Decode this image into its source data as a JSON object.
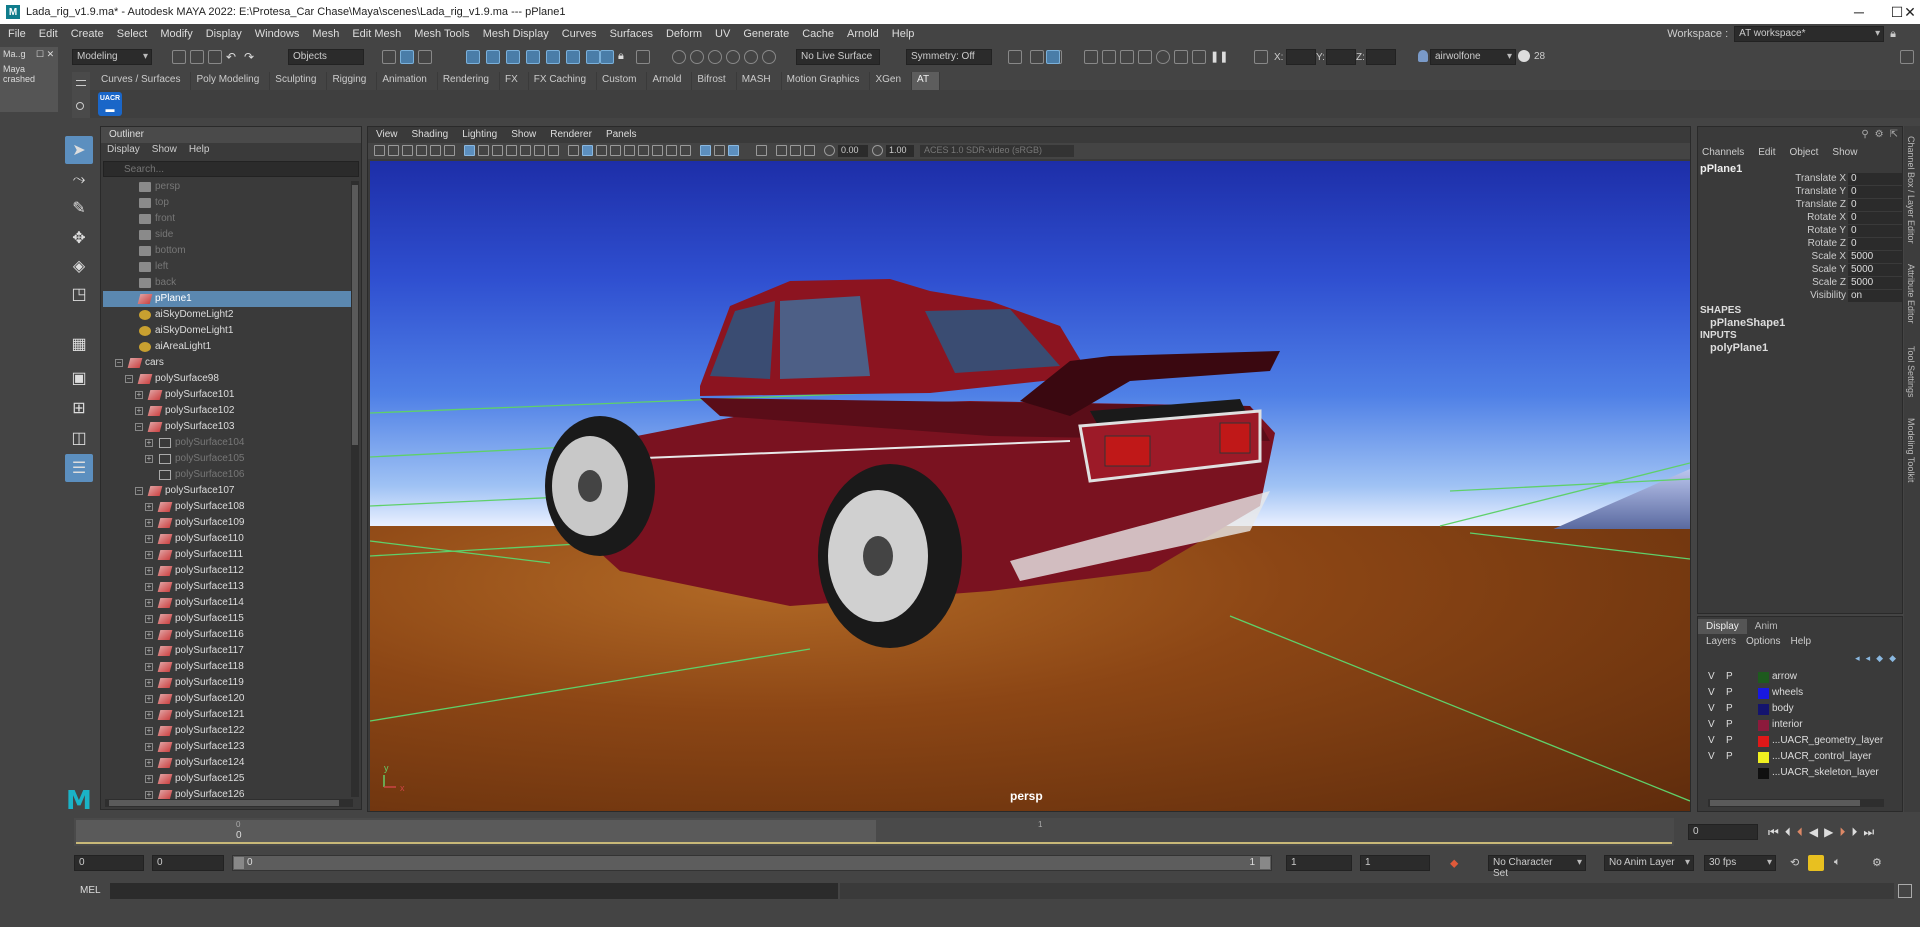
{
  "titlebar": {
    "title": "Lada_rig_v1.9.ma* - Autodesk MAYA 2022: E:\\Protesa_Car Chase\\Maya\\scenes\\Lada_rig_v1.9.ma  ---   pPlane1",
    "logo": "M"
  },
  "menubar": {
    "items": [
      "File",
      "Edit",
      "Create",
      "Select",
      "Modify",
      "Display",
      "Windows",
      "Mesh",
      "Edit Mesh",
      "Mesh Tools",
      "Mesh Display",
      "Curves",
      "Surfaces",
      "Deform",
      "UV",
      "Generate",
      "Cache",
      "Arnold",
      "Help"
    ],
    "workspace_label": "Workspace :",
    "workspace_value": "AT workspace*"
  },
  "statusline": {
    "mode": "Modeling",
    "select_mode": "Objects",
    "live_surface": "No Live Surface",
    "symmetry": "Symmetry: Off",
    "x_label": "X:",
    "y_label": "Y:",
    "z_label": "Z:",
    "user": "airwolfone",
    "notifications": "28"
  },
  "crashside": {
    "tab": "Ma..g",
    "message": "Maya crashed"
  },
  "shelf": {
    "tabs": [
      "Curves / Surfaces",
      "Poly Modeling",
      "Sculpting",
      "Rigging",
      "Animation",
      "Rendering",
      "FX",
      "FX Caching",
      "Custom",
      "Arnold",
      "Bifrost",
      "MASH",
      "Motion Graphics",
      "XGen",
      "AT"
    ],
    "active_tab": "AT",
    "uacr_label": "UACR"
  },
  "outliner": {
    "title": "Outliner",
    "menu": [
      "Display",
      "Show",
      "Help"
    ],
    "search_placeholder": "Search...",
    "rows": [
      {
        "name": "persp",
        "depth": 2,
        "icon": "cam",
        "dim": true
      },
      {
        "name": "top",
        "depth": 2,
        "icon": "cam",
        "dim": true
      },
      {
        "name": "front",
        "depth": 2,
        "icon": "cam",
        "dim": true
      },
      {
        "name": "side",
        "depth": 2,
        "icon": "cam",
        "dim": true
      },
      {
        "name": "bottom",
        "depth": 2,
        "icon": "cam",
        "dim": true
      },
      {
        "name": "left",
        "depth": 2,
        "icon": "cam",
        "dim": true
      },
      {
        "name": "back",
        "depth": 2,
        "icon": "cam",
        "dim": true
      },
      {
        "name": "pPlane1",
        "depth": 2,
        "icon": "mesh",
        "selected": true
      },
      {
        "name": "aiSkyDomeLight2",
        "depth": 2,
        "icon": "light"
      },
      {
        "name": "aiSkyDomeLight1",
        "depth": 2,
        "icon": "light"
      },
      {
        "name": "aiAreaLight1",
        "depth": 2,
        "icon": "light"
      },
      {
        "name": "cars",
        "depth": 1,
        "icon": "mesh",
        "exp": "−"
      },
      {
        "name": "polySurface98",
        "depth": 2,
        "icon": "mesh",
        "exp": "−"
      },
      {
        "name": "polySurface101",
        "depth": 3,
        "icon": "mesh",
        "exp": "+"
      },
      {
        "name": "polySurface102",
        "depth": 3,
        "icon": "mesh",
        "exp": "+"
      },
      {
        "name": "polySurface103",
        "depth": 3,
        "icon": "mesh",
        "exp": "−"
      },
      {
        "name": "polySurface104",
        "depth": 4,
        "icon": "grp",
        "exp": "+",
        "dim": true
      },
      {
        "name": "polySurface105",
        "depth": 4,
        "icon": "grp",
        "exp": "+",
        "dim": true
      },
      {
        "name": "polySurface106",
        "depth": 4,
        "icon": "grp",
        "dim": true
      },
      {
        "name": "polySurface107",
        "depth": 3,
        "icon": "mesh",
        "exp": "−"
      },
      {
        "name": "polySurface108",
        "depth": 4,
        "icon": "mesh",
        "exp": "+"
      },
      {
        "name": "polySurface109",
        "depth": 4,
        "icon": "mesh",
        "exp": "+"
      },
      {
        "name": "polySurface110",
        "depth": 4,
        "icon": "mesh",
        "exp": "+"
      },
      {
        "name": "polySurface111",
        "depth": 4,
        "icon": "mesh",
        "exp": "+"
      },
      {
        "name": "polySurface112",
        "depth": 4,
        "icon": "mesh",
        "exp": "+"
      },
      {
        "name": "polySurface113",
        "depth": 4,
        "icon": "mesh",
        "exp": "+"
      },
      {
        "name": "polySurface114",
        "depth": 4,
        "icon": "mesh",
        "exp": "+"
      },
      {
        "name": "polySurface115",
        "depth": 4,
        "icon": "mesh",
        "exp": "+"
      },
      {
        "name": "polySurface116",
        "depth": 4,
        "icon": "mesh",
        "exp": "+"
      },
      {
        "name": "polySurface117",
        "depth": 4,
        "icon": "mesh",
        "exp": "+"
      },
      {
        "name": "polySurface118",
        "depth": 4,
        "icon": "mesh",
        "exp": "+"
      },
      {
        "name": "polySurface119",
        "depth": 4,
        "icon": "mesh",
        "exp": "+"
      },
      {
        "name": "polySurface120",
        "depth": 4,
        "icon": "mesh",
        "exp": "+"
      },
      {
        "name": "polySurface121",
        "depth": 4,
        "icon": "mesh",
        "exp": "+"
      },
      {
        "name": "polySurface122",
        "depth": 4,
        "icon": "mesh",
        "exp": "+"
      },
      {
        "name": "polySurface123",
        "depth": 4,
        "icon": "mesh",
        "exp": "+"
      },
      {
        "name": "polySurface124",
        "depth": 4,
        "icon": "mesh",
        "exp": "+"
      },
      {
        "name": "polySurface125",
        "depth": 4,
        "icon": "mesh",
        "exp": "+"
      },
      {
        "name": "polySurface126",
        "depth": 4,
        "icon": "mesh",
        "exp": "+"
      }
    ]
  },
  "viewport": {
    "menu": [
      "View",
      "Shading",
      "Lighting",
      "Show",
      "Renderer",
      "Panels"
    ],
    "exposure": "0.00",
    "gamma": "1.00",
    "colorspace": "ACES 1.0 SDR-video (sRGB)",
    "camera_label": "persp",
    "axis_y": "y",
    "axis_x": "x",
    "colors": {
      "car_body": "#8c1420",
      "car_dark": "#4a0a12",
      "grid": "#5fd06a"
    }
  },
  "channelbox": {
    "menu": [
      "Channels",
      "Edit",
      "Object",
      "Show"
    ],
    "object": "pPlane1",
    "channels": [
      {
        "label": "Translate X",
        "value": "0"
      },
      {
        "label": "Translate Y",
        "value": "0"
      },
      {
        "label": "Translate Z",
        "value": "0"
      },
      {
        "label": "Rotate X",
        "value": "0"
      },
      {
        "label": "Rotate Y",
        "value": "0"
      },
      {
        "label": "Rotate Z",
        "value": "0"
      },
      {
        "label": "Scale X",
        "value": "5000"
      },
      {
        "label": "Scale Y",
        "value": "5000"
      },
      {
        "label": "Scale Z",
        "value": "5000"
      },
      {
        "label": "Visibility",
        "value": "on"
      }
    ],
    "shapes_label": "SHAPES",
    "shape_name": "pPlaneShape1",
    "inputs_label": "INPUTS",
    "input_name": "polyPlane1"
  },
  "sidetabs": [
    "Channel Box / Layer Editor",
    "Attribute Editor",
    "Tool Settings",
    "Modeling Toolkit"
  ],
  "layereditor": {
    "tabs": [
      "Display",
      "Anim"
    ],
    "menu": [
      "Layers",
      "Options",
      "Help"
    ],
    "layers": [
      {
        "v": "V",
        "p": "P",
        "color": "#1e5a1e",
        "name": "arrow"
      },
      {
        "v": "V",
        "p": "P",
        "color": "#1818e0",
        "name": "wheels"
      },
      {
        "v": "V",
        "p": "P",
        "color": "#14146e",
        "name": "body"
      },
      {
        "v": "V",
        "p": "P",
        "color": "#8c1a3c",
        "name": "interior"
      },
      {
        "v": "V",
        "p": "P",
        "color": "#e01818",
        "name": "...UACR_geometry_layer"
      },
      {
        "v": "V",
        "p": "P",
        "color": "#f0f020",
        "name": "...UACR_control_layer"
      },
      {
        "v": "",
        "p": "",
        "color": "#101010",
        "name": "...UACR_skeleton_layer"
      }
    ]
  },
  "timeline": {
    "start_tick": "0",
    "current_frame": "0",
    "marker": "1",
    "current_time_field": "0"
  },
  "rangebar": {
    "start": "0",
    "anim_start": "0",
    "slider_start": "0",
    "slider_end": "1",
    "anim_end": "1",
    "end": "1",
    "character_set": "No Character Set",
    "anim_layer": "No Anim Layer",
    "fps": "30 fps"
  },
  "cmdline": {
    "label": "MEL"
  }
}
